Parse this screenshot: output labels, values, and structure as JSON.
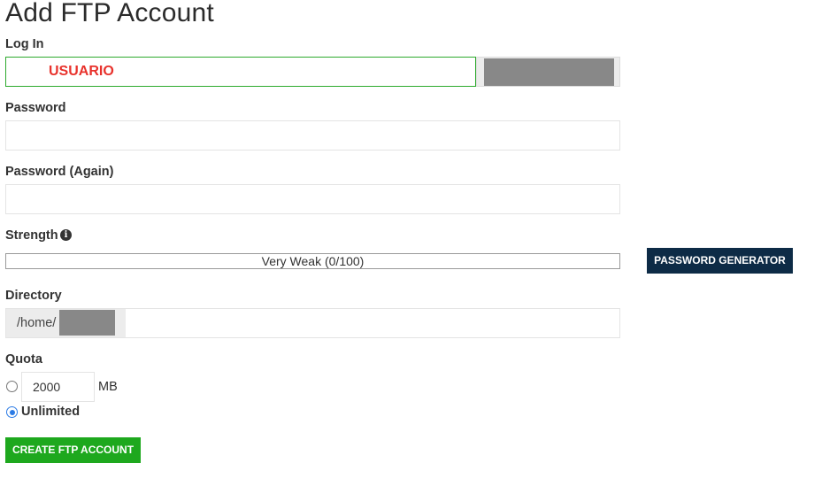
{
  "page": {
    "title": "Add FTP Account"
  },
  "login": {
    "label": "Log In",
    "value": "USUARIO",
    "domain_value": ""
  },
  "password": {
    "label": "Password",
    "value": ""
  },
  "password_again": {
    "label": "Password (Again)",
    "value": ""
  },
  "strength": {
    "label": "Strength",
    "text": "Very Weak (0/100)",
    "percent": 0,
    "info_icon": "info-circle-icon"
  },
  "password_generator": {
    "label": "PASSWORD GENERATOR"
  },
  "directory": {
    "label": "Directory",
    "prefix": "/home/",
    "value": ""
  },
  "quota": {
    "label": "Quota",
    "limited_value": "2000",
    "unit": "MB",
    "unlimited_label": "Unlimited",
    "selected": "unlimited"
  },
  "create_button": {
    "label": "CREATE FTP ACCOUNT"
  },
  "colors": {
    "primary_button": "#0d2b46",
    "create_button": "#1ea81e",
    "valid_border": "#2eaa2e",
    "login_text": "#e8322c",
    "radio_selected": "#2c7be5"
  }
}
